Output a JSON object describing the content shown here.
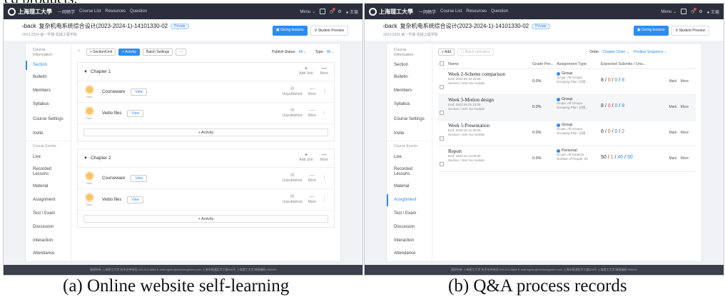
{
  "top_text": "ed products.",
  "nav": {
    "logo_text": "上海理工大學",
    "links": [
      "一网畅学",
      "Course List",
      "Resources",
      "Question"
    ],
    "menu": "Menu",
    "user": "王瑜"
  },
  "course": {
    "back": "back",
    "title": "复杂机电系统综合设计(2023-2024-1)-14101330-02",
    "privacy": "Private",
    "subline": "2023-2024 第一学期 机械工程学院",
    "giving_lessons": "Giving lessons",
    "student_preview": "Student Preview"
  },
  "sidebar_a": {
    "section_title": "Course Information",
    "items": [
      "Section",
      "Bulletin",
      "Members",
      "Syllabus",
      "Course Settings",
      "Invite"
    ],
    "events_title": "Course Events",
    "event_items": [
      "Live",
      "Recorded Lessons",
      "Material",
      "Assignment",
      "Test / Exam",
      "Discussion",
      "Interaction",
      "Attendance"
    ]
  },
  "panel_a": {
    "toolbar": {
      "section_unit": "+ Section/Unit",
      "activity": "+ Activity",
      "batch": "Batch Settings",
      "more": "···",
      "publish_label": "Publish Status:",
      "publish_value": "All",
      "type_label": "Type:",
      "type_value": "All"
    },
    "chapters": [
      {
        "name": "Chapter 1",
        "rows": [
          {
            "name": "Courseware",
            "tag": "Files"
          },
          {
            "name": "Vedio files",
            "tag": "Files"
          }
        ]
      },
      {
        "name": "Chapter 2",
        "rows": [
          {
            "name": "Courseware",
            "tag": "Files"
          },
          {
            "name": "Vedio files",
            "tag": "Files"
          }
        ]
      }
    ],
    "add_unit": "Add Unit",
    "more": "More",
    "view": "View",
    "unpublished": "Unpublished",
    "add_activity": "+ Activity"
  },
  "panel_b": {
    "add": "+ Add",
    "batch": "Batch operation",
    "order_label": "Order:",
    "order_value": "Chapter Order",
    "sequence_value": "Positive Sequence",
    "columns": [
      "Name",
      "Grade Per...",
      "Assignment Type",
      "Expected Submits / Uns..."
    ],
    "rows": [
      {
        "name": "Week 2-Scheme comparison",
        "end": "End:  2023.09.18 23:55",
        "section": "Section / Unit:  No module",
        "grade": "0.0%",
        "type": "Group",
        "scope": "Scope:  All Groups",
        "plan": "Grouping Plan:  分组...",
        "e1": "8",
        "e2": "0",
        "e3": "0",
        "e4": "8"
      },
      {
        "name": "Week 3-Motion design",
        "end": "End:  2023.09.25 23:55",
        "section": "Section / Unit:  No module",
        "grade": "0.0%",
        "type": "Group",
        "scope": "Scope:  All Groups",
        "plan": "Grouping Plan:  分组...",
        "e1": "8",
        "e2": "0",
        "e3": "0",
        "e4": "8"
      },
      {
        "name": "Week 5-Presentation",
        "end": "End:  2023.10.14 00:00",
        "section": "Section / Unit:  No module",
        "grade": "0.0%",
        "type": "Group",
        "scope": "Scope:  All Groups",
        "plan": "Grouping Plan:  分组...",
        "e1": "8",
        "e2": "0",
        "e3": "0",
        "e4": "2"
      },
      {
        "name": "Report",
        "end": "End:  2023.10.14 00:00",
        "section": "Section / Unit:  No module",
        "grade": "0.0%",
        "type": "Personal",
        "scope": "Scope:  All students",
        "plan": "Number of People:  50",
        "e1": "50",
        "e2": "1",
        "e3": "40",
        "e4": "50"
      }
    ],
    "mark": "Mark",
    "more": "More"
  },
  "footer": "版权所有 上海理工大学 技术支持电话:029-81116868 E-mail:wgeitu@wisdomgarden.com 上海市杨浦区军工路516号 上海理工大学 邮政编码:200093",
  "captions": {
    "a": "(a) Online website self-learning",
    "b": "(b) Q&A process records"
  },
  "colors": {
    "accent": "#2d8cf0",
    "nav_bg": "#2a2f3b",
    "alert": "#e84a3c"
  }
}
